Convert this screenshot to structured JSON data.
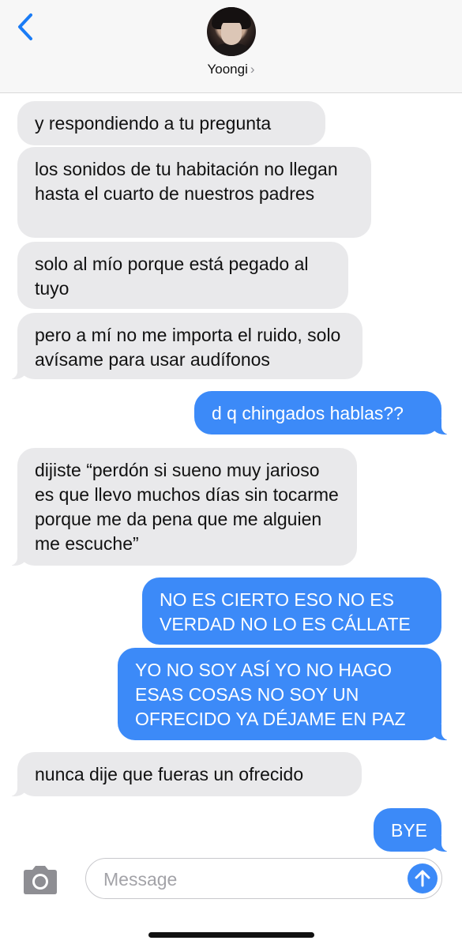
{
  "header": {
    "contact_name": "Yoongi",
    "name_chevron": "›"
  },
  "messages": [
    {
      "side": "received",
      "text": "y respondiendo a tu pregunta"
    },
    {
      "side": "received",
      "text": "los sonidos de tu habitación no llegan hasta el cuarto de nuestros padres"
    },
    {
      "side": "received",
      "text": "solo al mío porque está pegado al tuyo"
    },
    {
      "side": "received",
      "text": "pero a mí no me importa el ruido, solo avísame para usar audífonos"
    },
    {
      "side": "sent",
      "text": "d q chingados hablas??"
    },
    {
      "side": "received",
      "text": "dijiste “perdón si sueno muy jarioso es que llevo muchos días sin tocarme porque me da pena que me alguien me escuche”"
    },
    {
      "side": "sent",
      "text": "NO ES CIERTO ESO NO ES VERDAD NO LO ES CÁLLATE"
    },
    {
      "side": "sent",
      "text": "YO NO SOY ASÍ YO NO HAGO ESAS COSAS NO SOY UN OFRECIDO YA DÉJAME EN PAZ"
    },
    {
      "side": "received",
      "text": "nunca dije que fueras un ofrecido"
    },
    {
      "side": "sent",
      "text": "BYE"
    }
  ],
  "input": {
    "placeholder": "Message",
    "value": ""
  },
  "icons": {
    "back": "chevron-left-icon",
    "camera": "camera-icon",
    "send": "arrow-up-icon"
  },
  "colors": {
    "sent_bubble": "#3c8af8",
    "received_bubble": "#e9e9eb",
    "accent": "#1a7cf6"
  }
}
